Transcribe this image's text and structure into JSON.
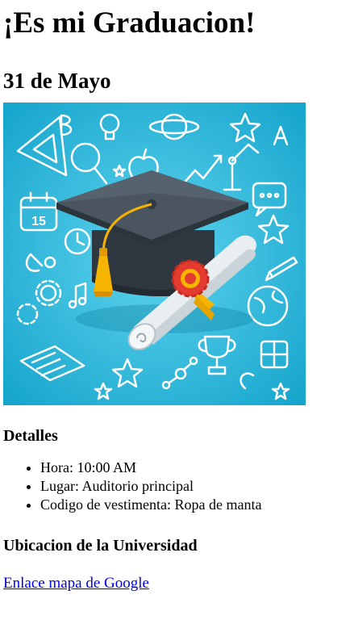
{
  "header": {
    "title": "¡Es mi Graduacion!",
    "date": "31 de Mayo"
  },
  "hero_image": {
    "icon": "graduation-cap-diploma-illustration",
    "label": "15",
    "colors": {
      "background": "#1fb1d6",
      "cap": "#414b55",
      "tassel": "#f5b400",
      "seal": "#e33b2f"
    }
  },
  "details": {
    "heading": "Detalles",
    "items": [
      "Hora: 10:00 AM",
      "Lugar: Auditorio principal",
      "Codigo de vestimenta: Ropa de manta"
    ]
  },
  "university": {
    "heading": "Ubicacion de la Universidad",
    "link_text": "Enlace mapa de Google"
  }
}
